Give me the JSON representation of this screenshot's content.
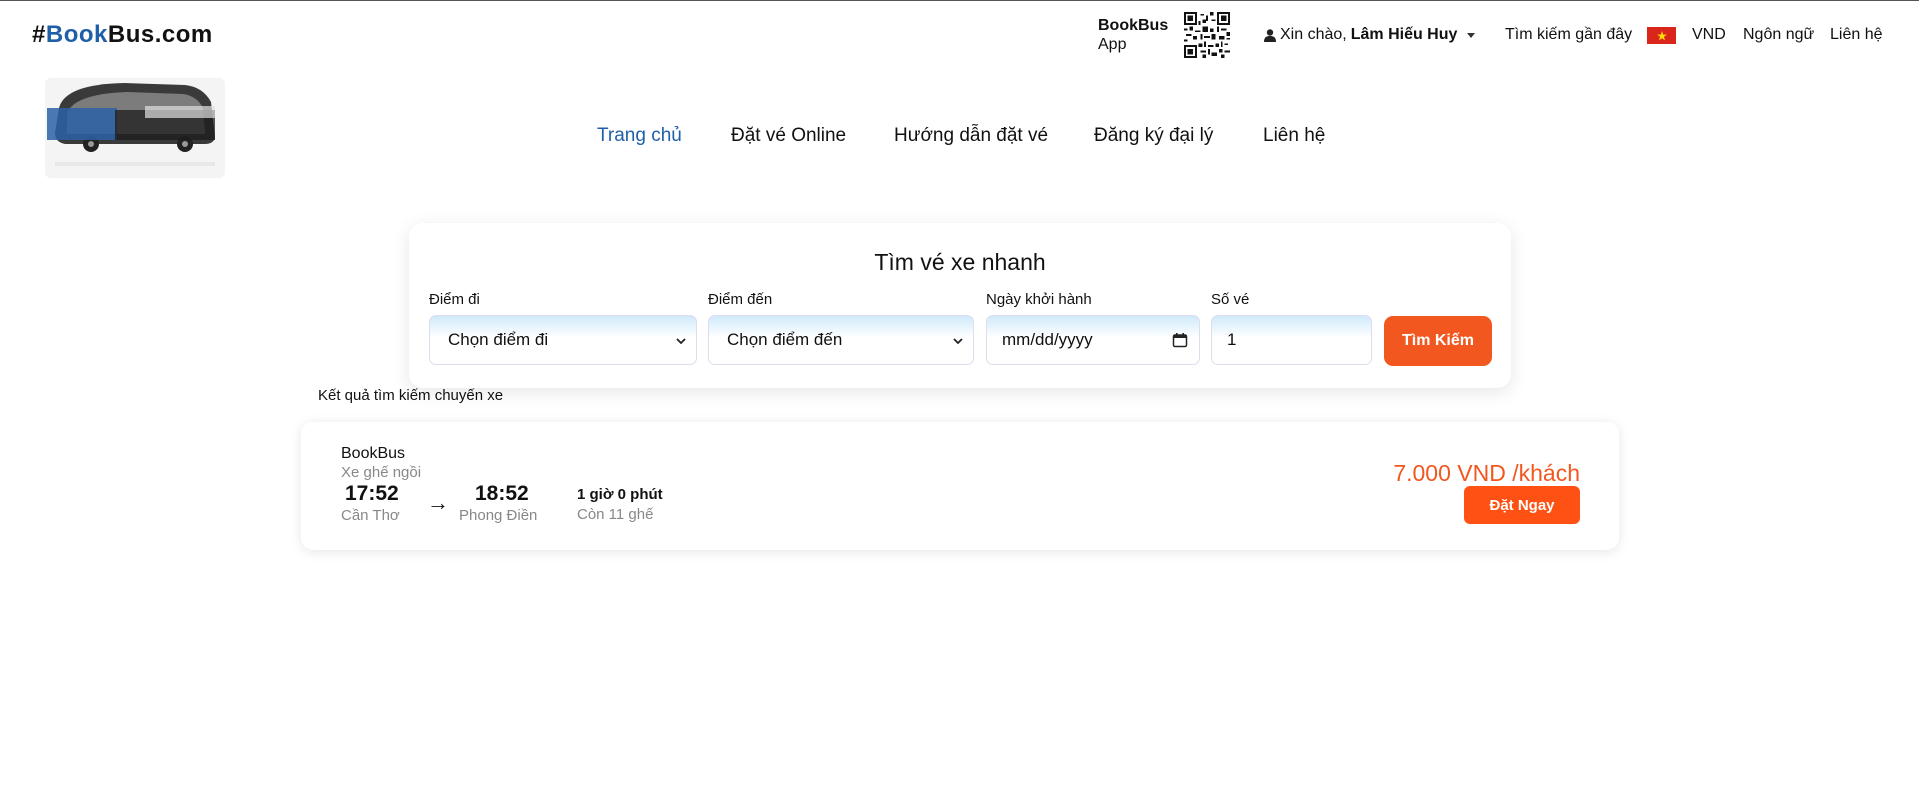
{
  "header": {
    "brand_hash": "#",
    "brand_book": "Book",
    "brand_rest": "Bus.com",
    "app_line1": "BookBus",
    "app_line2": "App",
    "greeting": "Xin chào,",
    "user_name": "Lâm Hiếu Huy",
    "recent_search": "Tìm kiếm gần đây",
    "currency": "VND",
    "language": "Ngôn ngữ",
    "contact": "Liên hệ"
  },
  "nav": {
    "items": [
      {
        "label": "Trang chủ",
        "active": true
      },
      {
        "label": "Đặt vé Online"
      },
      {
        "label": "Hướng dẫn đặt vé"
      },
      {
        "label": "Đăng ký đại lý"
      },
      {
        "label": "Liên hệ"
      }
    ]
  },
  "search": {
    "title": "Tìm vé xe nhanh",
    "from_label": "Điểm đi",
    "from_value": "Chọn điểm đi",
    "to_label": "Điểm đến",
    "to_value": "Chọn điểm đến",
    "date_label": "Ngày khởi hành",
    "date_placeholder": "mm/dd/yyyy",
    "tickets_label": "Số vé",
    "tickets_value": "1",
    "button": "Tìm Kiếm"
  },
  "results": {
    "label": "Kết quả tìm kiếm chuyến xe",
    "trips": [
      {
        "operator": "BookBus",
        "seat_type": "Xe ghế ngồi",
        "depart_time": "17:52",
        "depart_place": "Cần Thơ",
        "arrow": "→",
        "arrive_time": "18:52",
        "arrive_place": "Phong Điền",
        "duration": "1 giờ 0 phút",
        "seats_left": "Còn 11 ghế",
        "price": "7.000 VND /khách",
        "book_button": "Đặt Ngay"
      }
    ]
  },
  "colors": {
    "accent": "#f2571f",
    "link_active": "#1f5fa8"
  }
}
